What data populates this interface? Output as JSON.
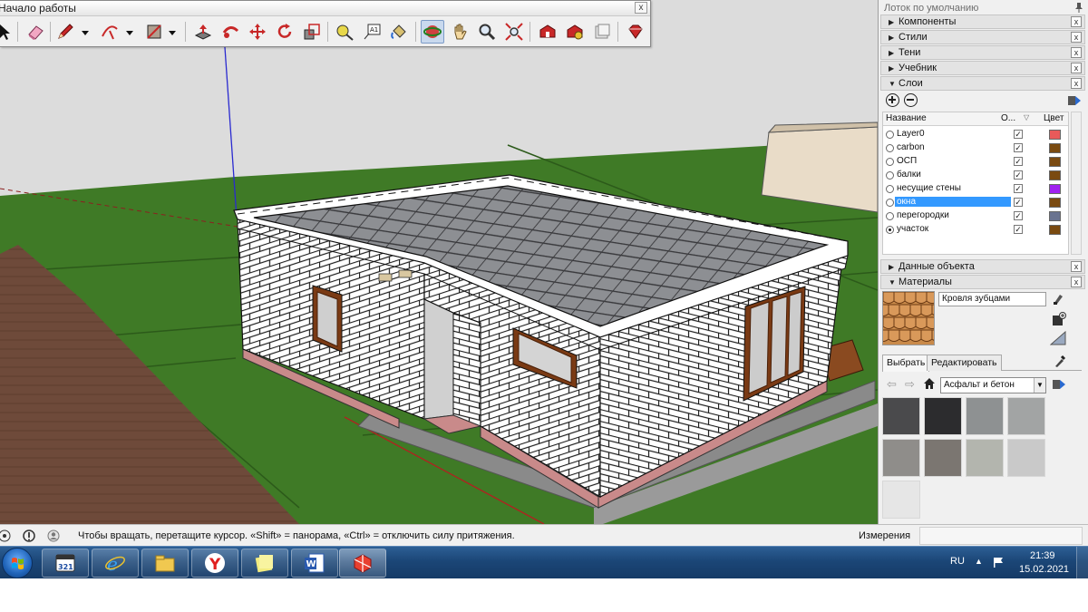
{
  "toolbar": {
    "title": "Начало работы",
    "close_label": "x",
    "tools": [
      {
        "name": "select-tool",
        "icon": "arrow-icon"
      },
      {
        "name": "eraser-tool",
        "icon": "eraser-icon"
      },
      {
        "name": "pencil-tool",
        "icon": "pencil-icon"
      },
      {
        "name": "arc-tool",
        "icon": "arc-icon"
      },
      {
        "name": "rectangle-tool",
        "icon": "rectangle-icon"
      },
      {
        "name": "push-pull-tool",
        "icon": "push-pull-icon"
      },
      {
        "name": "follow-me-tool",
        "icon": "follow-me-icon"
      },
      {
        "name": "move-tool",
        "icon": "move-icon"
      },
      {
        "name": "rotate-tool",
        "icon": "rotate-icon"
      },
      {
        "name": "scale-tool",
        "icon": "scale-icon"
      },
      {
        "name": "tape-measure-tool",
        "icon": "tape-icon"
      },
      {
        "name": "text-tool",
        "icon": "text-icon"
      },
      {
        "name": "paint-bucket-tool",
        "icon": "paint-bucket-icon"
      },
      {
        "name": "orbit-tool",
        "icon": "orbit-icon"
      },
      {
        "name": "pan-tool",
        "icon": "hand-icon"
      },
      {
        "name": "zoom-tool",
        "icon": "magnifier-icon"
      },
      {
        "name": "zoom-extents-tool",
        "icon": "zoom-extents-icon"
      },
      {
        "name": "3d-warehouse-tool",
        "icon": "warehouse-icon"
      },
      {
        "name": "extension-warehouse-tool",
        "icon": "extension-icon"
      },
      {
        "name": "send-to-layout-tool",
        "icon": "layout-icon"
      },
      {
        "name": "extension-manager-tool",
        "icon": "ruby-icon"
      }
    ]
  },
  "tray": {
    "title": "Лоток по умолчанию",
    "panels": {
      "components": "Компоненты",
      "styles": "Стили",
      "shadows": "Тени",
      "instructor": "Учебник",
      "layers": "Слои",
      "entity_info": "Данные объекта",
      "materials": "Материалы"
    },
    "close_label": "x"
  },
  "layers": {
    "header_name": "Название",
    "header_visible": "О...",
    "header_color": "Цвет",
    "rows": [
      {
        "name": "Layer0",
        "active": false,
        "visible": true,
        "color": "#e85a5a",
        "selected": false
      },
      {
        "name": "carbon",
        "active": false,
        "visible": true,
        "color": "#7a4a10",
        "selected": false
      },
      {
        "name": "ОСП",
        "active": false,
        "visible": true,
        "color": "#7a4a10",
        "selected": false
      },
      {
        "name": "балки",
        "active": false,
        "visible": true,
        "color": "#7a4a10",
        "selected": false
      },
      {
        "name": "несущие стены",
        "active": false,
        "visible": true,
        "color": "#a020f0",
        "selected": false
      },
      {
        "name": "окна",
        "active": false,
        "visible": true,
        "color": "#7a4a10",
        "selected": true
      },
      {
        "name": "перегородки",
        "active": false,
        "visible": true,
        "color": "#6a7390",
        "selected": false
      },
      {
        "name": "участок",
        "active": true,
        "visible": true,
        "color": "#7a4a10",
        "selected": false
      }
    ]
  },
  "materials": {
    "current_name": "Кровля зубцами",
    "tab_select": "Выбрать",
    "tab_edit": "Редактировать",
    "library": "Асфальт и бетон",
    "swatches": [
      "#4a4a4c",
      "#2c2c2e",
      "#8e9192",
      "#a2a4a4",
      "#8f8d8a",
      "#7b7671",
      "#b3b5ae",
      "#c9c9c9",
      "#e6e6e6"
    ]
  },
  "status": {
    "hint": "Чтобы вращать, перетащите курсор. «Shift» = панорама, «Ctrl» = отключить силу притяжения.",
    "measurements_label": "Измерения",
    "measurements_value": ""
  },
  "taskbar": {
    "apps": [
      "media-player",
      "internet-explorer",
      "file-explorer",
      "yandex-browser",
      "sticky-notes",
      "word",
      "sketchup"
    ],
    "media_badge": "321",
    "language": "RU",
    "time": "21:39",
    "date": "15.02.2021"
  }
}
